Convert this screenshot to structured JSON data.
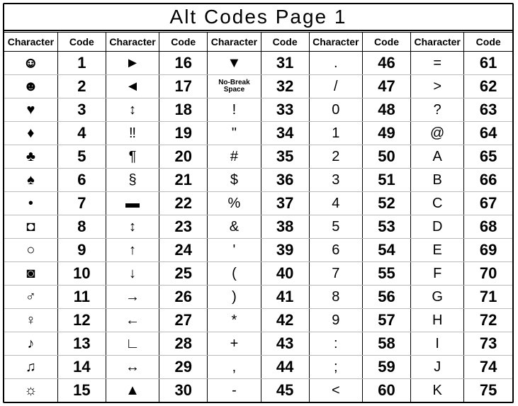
{
  "title": "Alt Codes Page 1",
  "headers": [
    "Character",
    "Code",
    "Character",
    "Code",
    "Character",
    "Code",
    "Character",
    "Code",
    "Character",
    "Code"
  ],
  "rows": [
    [
      {
        "char": "☺",
        "cls": "outline"
      },
      "1",
      "►",
      "16",
      "▼",
      "31",
      ".",
      "46",
      "=",
      "61"
    ],
    [
      "☻",
      "2",
      "◄",
      "17",
      {
        "char": "No-Break\nSpace",
        "cls": "small"
      },
      "32",
      "/",
      "47",
      ">",
      "62"
    ],
    [
      "♥",
      "3",
      "↕",
      "18",
      "!",
      "33",
      "0",
      "48",
      "?",
      "63"
    ],
    [
      "♦",
      "4",
      "‼",
      "19",
      "\"",
      "34",
      "1",
      "49",
      "@",
      "64"
    ],
    [
      "♣",
      "5",
      "¶",
      "20",
      "#",
      "35",
      "2",
      "50",
      "A",
      "65"
    ],
    [
      "♠",
      "6",
      "§",
      "21",
      "$",
      "36",
      "3",
      "51",
      "B",
      "66"
    ],
    [
      "•",
      "7",
      "▬",
      "22",
      "%",
      "37",
      "4",
      "52",
      "C",
      "67"
    ],
    [
      "◘",
      "8",
      "↕",
      "23",
      "&",
      "38",
      "5",
      "53",
      "D",
      "68"
    ],
    [
      "○",
      "9",
      "↑",
      "24",
      "'",
      "39",
      "6",
      "54",
      "E",
      "69"
    ],
    [
      "◙",
      "10",
      "↓",
      "25",
      "(",
      "40",
      "7",
      "55",
      "F",
      "70"
    ],
    [
      "♂",
      "11",
      "→",
      "26",
      ")",
      "41",
      "8",
      "56",
      "G",
      "71"
    ],
    [
      "♀",
      "12",
      "←",
      "27",
      "*",
      "42",
      "9",
      "57",
      "H",
      "72"
    ],
    [
      "♪",
      "13",
      "∟",
      "28",
      "+",
      "43",
      ":",
      "58",
      "I",
      "73"
    ],
    [
      "♫",
      "14",
      "↔",
      "29",
      ",",
      "44",
      ";",
      "59",
      "J",
      "74"
    ],
    [
      "☼",
      "15",
      "▲",
      "30",
      "-",
      "45",
      "<",
      "60",
      "K",
      "75"
    ]
  ]
}
